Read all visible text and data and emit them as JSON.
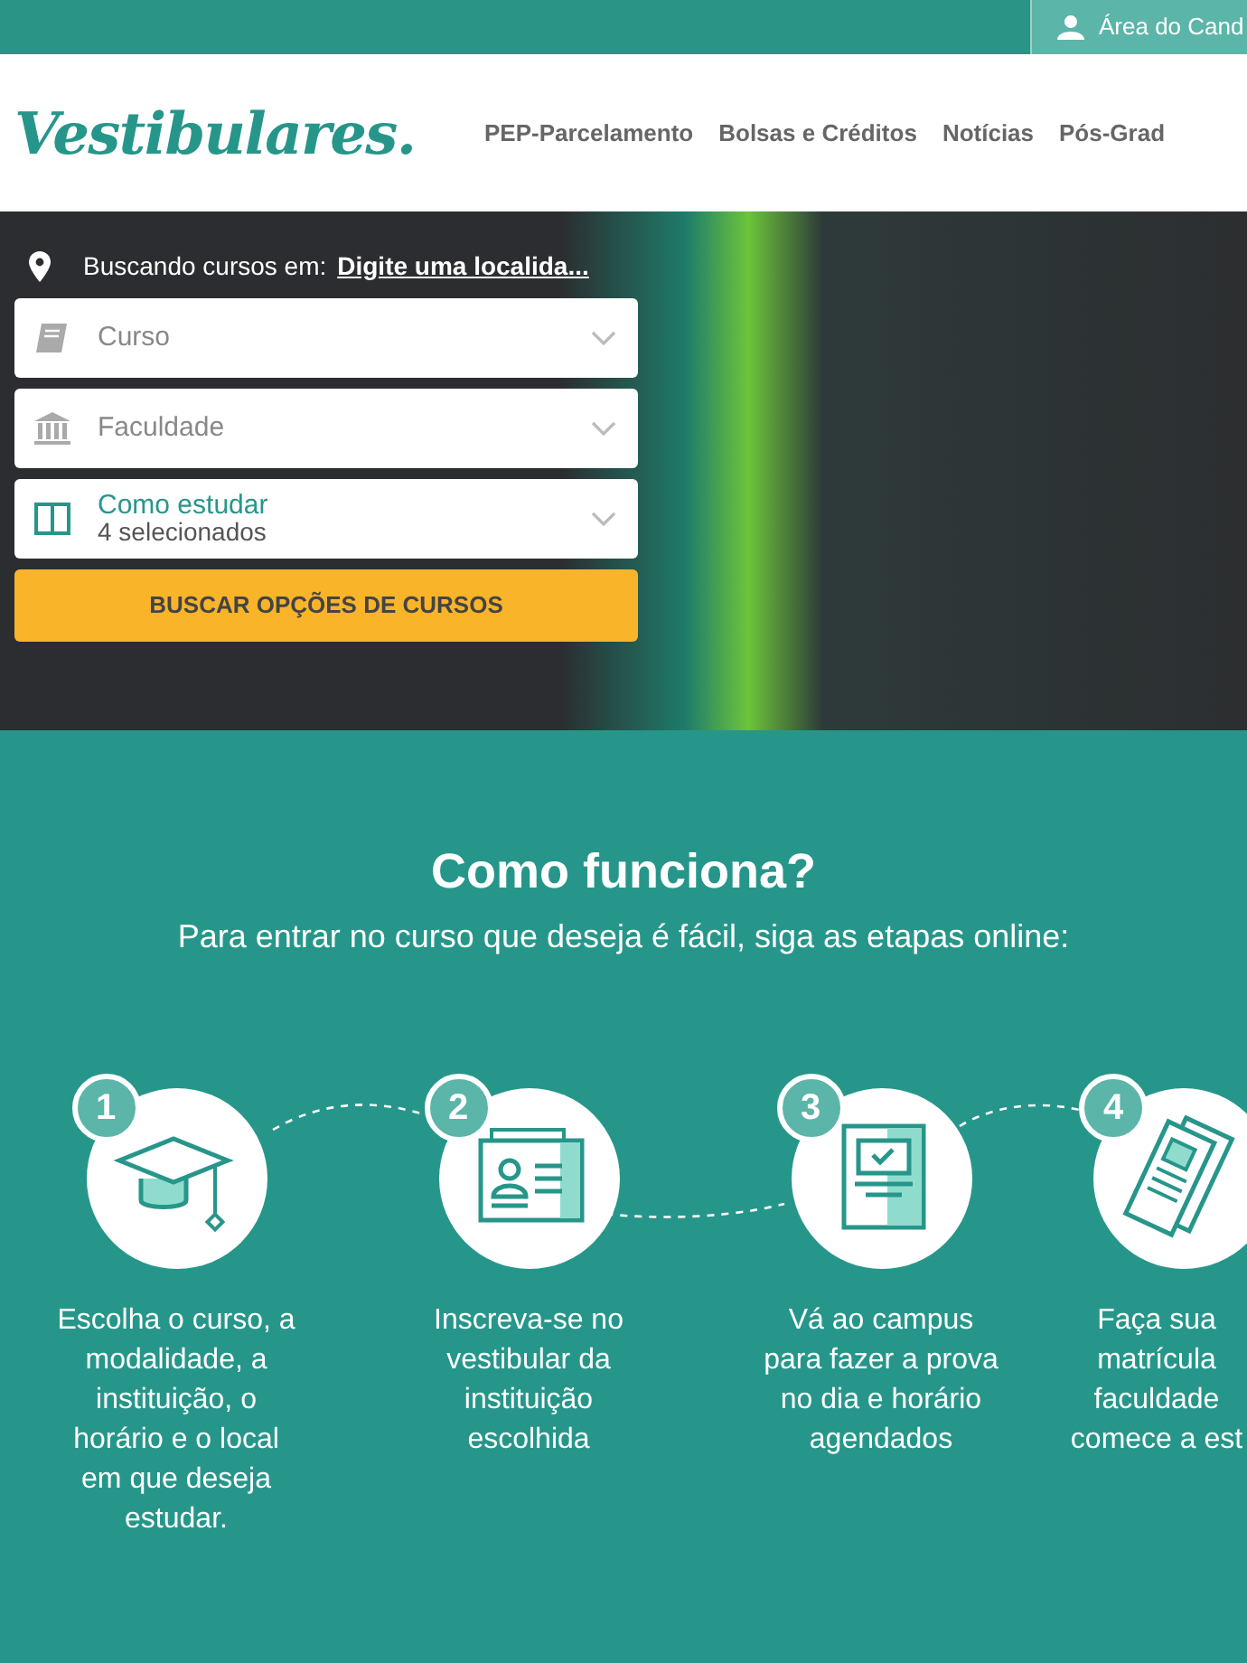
{
  "top_bar": {
    "account_link": "Área do Cand"
  },
  "header": {
    "logo": "Vestibulares.",
    "nav": [
      {
        "label": "PEP-Parcelamento"
      },
      {
        "label": "Bolsas e Créditos"
      },
      {
        "label": "Notícias"
      },
      {
        "label": "Pós-Grad"
      }
    ]
  },
  "search": {
    "location_label": "Buscando cursos em:",
    "location_link": "Digite uma localida...",
    "fields": [
      {
        "kind": "select",
        "placeholder": "Curso"
      },
      {
        "kind": "select",
        "placeholder": "Faculdade"
      },
      {
        "kind": "multi",
        "label": "Como estudar",
        "value": "4 selecionados"
      }
    ],
    "button": "BUSCAR OPÇÕES DE CURSOS"
  },
  "how_it_works": {
    "title": "Como funciona?",
    "subtitle": "Para entrar no curso que deseja é fácil, siga as etapas online:",
    "steps": [
      {
        "number": "1",
        "lines": [
          "Escolha o curso, a",
          "modalidade, a",
          "instituição, o",
          "horário e o local",
          "em que deseja",
          "estudar."
        ]
      },
      {
        "number": "2",
        "lines": [
          "Inscreva-se no",
          "vestibular da",
          "instituição",
          "escolhida"
        ]
      },
      {
        "number": "3",
        "lines": [
          "Vá ao campus",
          "para fazer a prova",
          "no dia e horário",
          "agendados"
        ]
      },
      {
        "number": "4",
        "lines": [
          "Faça sua",
          "matrícula",
          "faculdade",
          "comece a est"
        ]
      }
    ]
  }
}
